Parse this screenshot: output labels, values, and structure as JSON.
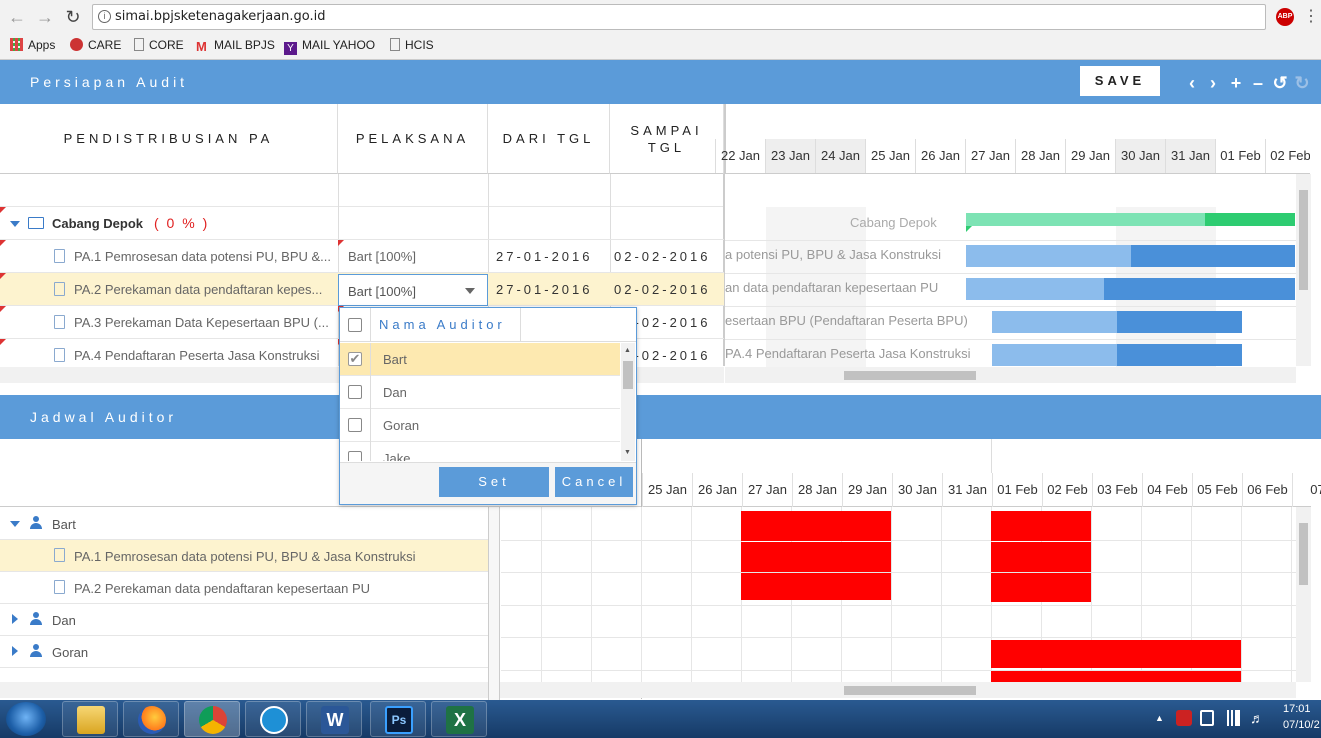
{
  "browser": {
    "url": "simai.bpjsketenagakerjaan.go.id",
    "bookmarks": [
      "Apps",
      "CARE",
      "CORE",
      "MAIL BPJS",
      "MAIL YAHOO",
      "HCIS"
    ],
    "abp": "ABP"
  },
  "audit": {
    "title": "Persiapan Audit",
    "save_label": "SAVE",
    "columns": {
      "pa": "PENDISTRIBUSIAN PA",
      "pelaksana": "PELAKSANA",
      "dari": "DARI TGL",
      "sampai": "SAMPAI TGL"
    },
    "dates": [
      "22 Jan",
      "23 Jan",
      "24 Jan",
      "25 Jan",
      "26 Jan",
      "27 Jan",
      "28 Jan",
      "29 Jan",
      "30 Jan",
      "31 Jan",
      "01 Feb",
      "02 Feb"
    ],
    "branch": {
      "name": "Cabang Depok",
      "pct": "( 0 % )",
      "gantt_label": "Cabang Depok"
    },
    "rows": [
      {
        "name": "PA.1 Pemrosesan data potensi PU, BPU &...",
        "pelaksana": "Bart [100%]",
        "dari": "27-01-2016",
        "sampai": "02-02-2016",
        "gantt_label": "a potensi PU, BPU & Jasa Konstruksi",
        "progress": 0.5
      },
      {
        "name": "PA.2 Perekaman data pendaftaran kepes...",
        "pelaksana": "Bart [100%]",
        "dari": "27-01-2016",
        "sampai": "02-02-2016",
        "gantt_label": "an data pendaftaran kepesertaan PU",
        "progress": 0.42
      },
      {
        "name": "PA.3 Perekaman Data Kepesertaan BPU (...",
        "pelaksana": "",
        "dari": "",
        "sampai": "02-02-2016",
        "gantt_label": "esertaan BPU (Pendaftaran Peserta BPU)",
        "progress": 0.5
      },
      {
        "name": "PA.4 Pendaftaran Peserta Jasa Konstruksi",
        "pelaksana": "",
        "dari": "",
        "sampai": "02-02-2016",
        "gantt_label": "PA.4 Pendaftaran Peserta Jasa Konstruksi",
        "progress": 0.5
      }
    ]
  },
  "dropdown": {
    "header": "Nama Auditor",
    "options": [
      {
        "label": "Bart",
        "checked": true
      },
      {
        "label": "Dan",
        "checked": false
      },
      {
        "label": "Goran",
        "checked": false
      },
      {
        "label": "Jake",
        "checked": false
      }
    ],
    "set_label": "Set",
    "cancel_label": "Cancel"
  },
  "jadwal": {
    "title": "Jadwal Auditor",
    "dates": [
      "25 Jan",
      "26 Jan",
      "27 Jan",
      "28 Jan",
      "29 Jan",
      "30 Jan",
      "31 Jan",
      "01 Feb",
      "02 Feb",
      "03 Feb",
      "04 Feb",
      "05 Feb",
      "06 Feb",
      "07"
    ],
    "tree": [
      {
        "label": "Bart",
        "type": "user",
        "expanded": true
      },
      {
        "label": "PA.1 Pemrosesan data potensi PU, BPU & Jasa Konstruksi",
        "type": "task"
      },
      {
        "label": "PA.2 Perekaman data pendaftaran kepesertaan PU",
        "type": "task"
      },
      {
        "label": "Dan",
        "type": "user",
        "expanded": false
      },
      {
        "label": "Goran",
        "type": "user",
        "expanded": false
      }
    ]
  },
  "taskbar": {
    "time": "17:01",
    "date": "07/10/2"
  }
}
